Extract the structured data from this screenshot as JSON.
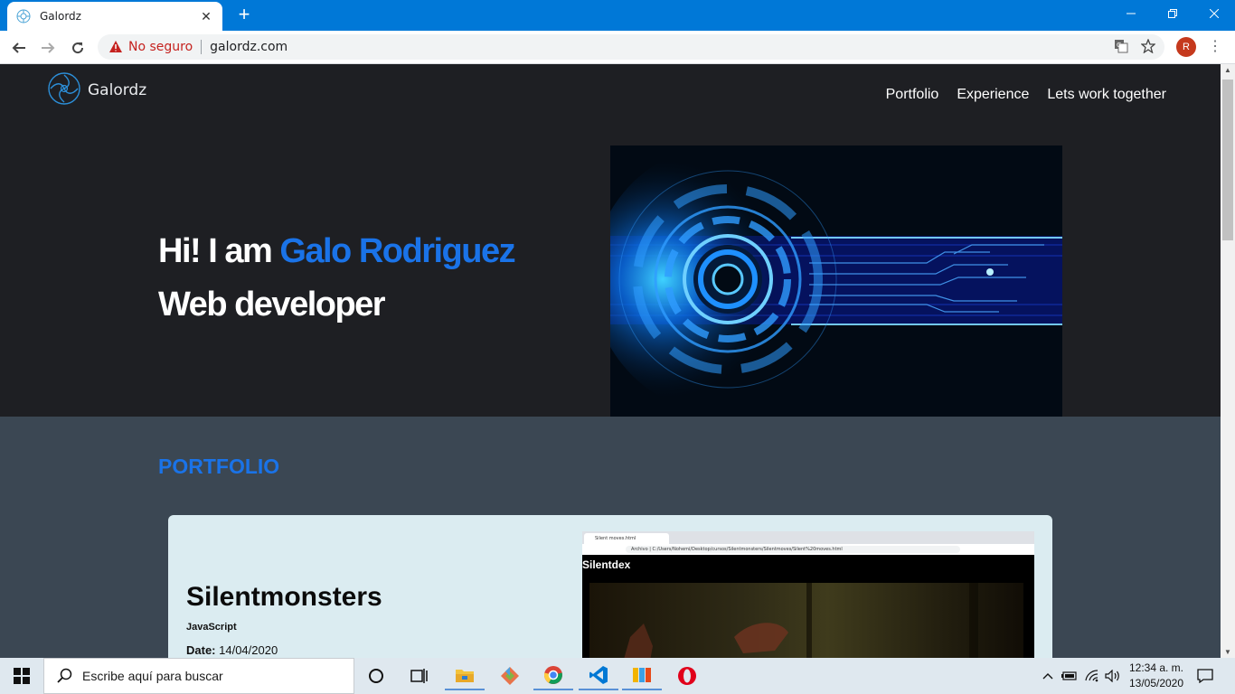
{
  "browser": {
    "tab_title": "Galordz",
    "tab_close": "✕",
    "new_tab": "+",
    "security_label": "No seguro",
    "url": "galordz.com",
    "profile_initial": "R"
  },
  "site": {
    "brand": "Galordz",
    "nav": [
      "Portfolio",
      "Experience",
      "Lets work together"
    ],
    "hero": {
      "greeting": "Hi! I am ",
      "name": "Galo Rodriguez",
      "role": "Web developer"
    },
    "portfolio": {
      "heading": "PORTFOLIO",
      "card": {
        "title": "Silentmonsters",
        "tech": "JavaScript",
        "date_label": "Date:",
        "date_value": " 14/04/2020",
        "screenshot": {
          "tab_title": "Silent moves.html",
          "address_text": "Archivo  |  C:/Users/Nohemi/Desktop/cursos/Silentmonsters/Silentmoves/Silent%20moves.html",
          "heading": "Silentdex"
        }
      }
    }
  },
  "taskbar": {
    "search_placeholder": "Escribe aquí para buscar",
    "time": "12:34 a. m.",
    "date": "13/05/2020"
  },
  "colors": {
    "accent_blue": "#1a73e8",
    "titlebar_blue": "#0078d7",
    "hero_bg": "#1e1f23",
    "portfolio_bg": "#3b4753",
    "card_bg": "#dbecf1"
  }
}
